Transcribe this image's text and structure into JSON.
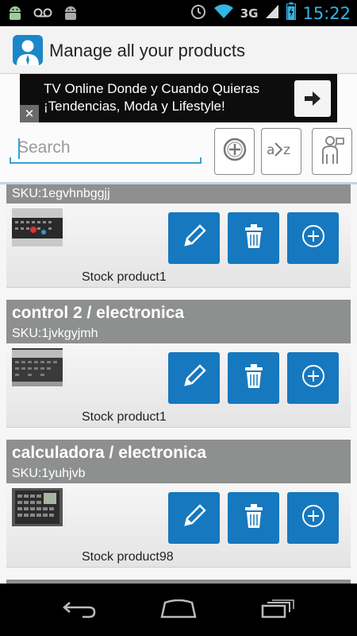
{
  "status_bar": {
    "network": "3G",
    "time": "15:22",
    "icons": [
      "android-icon",
      "voicemail-icon",
      "android-icon",
      "alarm-icon",
      "wifi-icon",
      "signal-icon",
      "battery-icon"
    ]
  },
  "app": {
    "title": "Manage all your products",
    "icon": "manager-avatar-icon"
  },
  "ad": {
    "line1": "TV Online Donde y Cuando Quieras",
    "line2": "¡Tendencias, Moda y Lifestyle!",
    "close_label": "✕",
    "arrow_icon": "arrow-right-icon"
  },
  "search": {
    "placeholder": "Search",
    "value": ""
  },
  "toolbar": {
    "buttons": [
      "add-product-icon",
      "sort-az-icon",
      "customer-icon"
    ]
  },
  "products": [
    {
      "name": "",
      "sku": "SKU:1egvhnbggjj",
      "stock": "Stock product1",
      "thumb": "remote-control"
    },
    {
      "name": "control 2 / electronica",
      "sku": "SKU:1jvkgyjmh",
      "stock": "Stock product1",
      "thumb": "remote-control"
    },
    {
      "name": "calculadora / electronica",
      "sku": "SKU:1yuhjvb",
      "stock": "Stock product98",
      "thumb": "calculator"
    }
  ],
  "card_actions": [
    "edit-icon",
    "delete-icon",
    "add-stock-icon"
  ],
  "colors": {
    "accent": "#1678be",
    "card_header": "#8e908f",
    "clock": "#33b5e5",
    "search_line": "#33a3d6"
  },
  "nav": [
    "back-icon",
    "home-icon",
    "recent-apps-icon"
  ]
}
